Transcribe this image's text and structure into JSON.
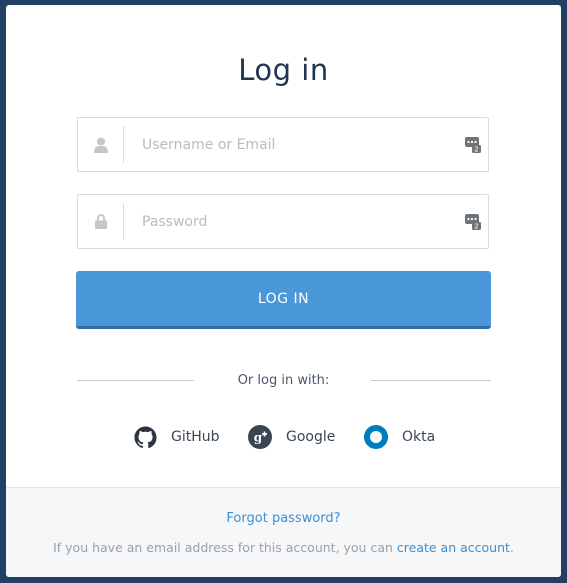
{
  "title": "Log in",
  "username": {
    "placeholder": "Username or Email",
    "value": ""
  },
  "password": {
    "placeholder": "Password",
    "value": ""
  },
  "login_button": "LOG IN",
  "divider_text": "Or log in with:",
  "providers": [
    {
      "label": "GitHub",
      "icon": "github-icon"
    },
    {
      "label": "Google",
      "icon": "google-plus-icon"
    },
    {
      "label": "Okta",
      "icon": "okta-icon"
    }
  ],
  "footer": {
    "forgot": "Forgot password?",
    "account_text": "If you have an email address for this account, you can",
    "account_link": "create an account",
    "account_end": "."
  },
  "colors": {
    "background": "#233f63",
    "primary": "#4a97d9",
    "link": "#3f8fd1",
    "okta": "#007dc1"
  }
}
